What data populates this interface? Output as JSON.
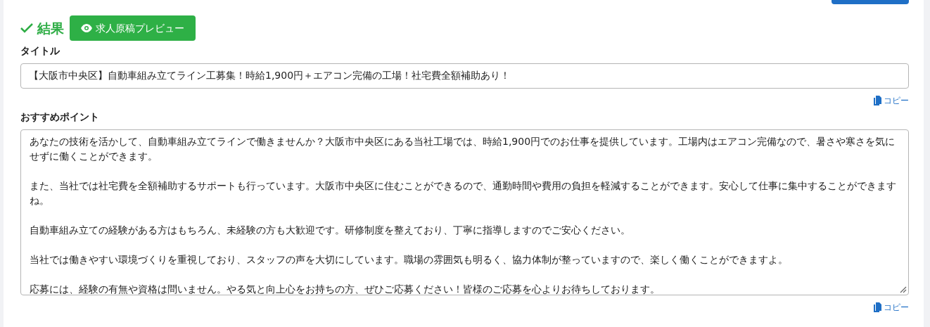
{
  "heading": {
    "label": "結果"
  },
  "preview_button": {
    "label": "求人原稿プレビュー"
  },
  "fields": [
    {
      "kind": "input",
      "label": "タイトル",
      "value": "【大阪市中央区】自動車組み立てライン工募集！時給1,900円＋エアコン完備の工場！社宅費全額補助あり！",
      "copy_label": "コピー"
    },
    {
      "kind": "textarea",
      "label": "おすすめポイント",
      "paragraphs": [
        "あなたの技術を活かして、自動車組み立てラインで働きませんか？大阪市中央区にある当社工場では、時給1,900円でのお仕事を提供しています。工場内はエアコン完備なので、暑さや寒さを気にせずに働くことができます。",
        "また、当社では社宅費を全額補助するサポートも行っています。大阪市中央区に住むことができるので、通勤時間や費用の負担を軽減することができます。安心して仕事に集中することができますね。",
        "自動車組み立ての経験がある方はもちろん、未経験の方も大歓迎です。研修制度を整えており、丁寧に指導しますのでご安心ください。",
        "当社では働きやすい環境づくりを重視しており、スタッフの声を大切にしています。職場の雰囲気も明るく、協力体制が整っていますので、楽しく働くことができますよ。",
        "応募には、経験の有無や資格は問いません。やる気と向上心をお持ちの方、ぜひご応募ください！皆様のご応募を心よりお待ちしております。"
      ],
      "copy_label": "コピー"
    }
  ]
}
